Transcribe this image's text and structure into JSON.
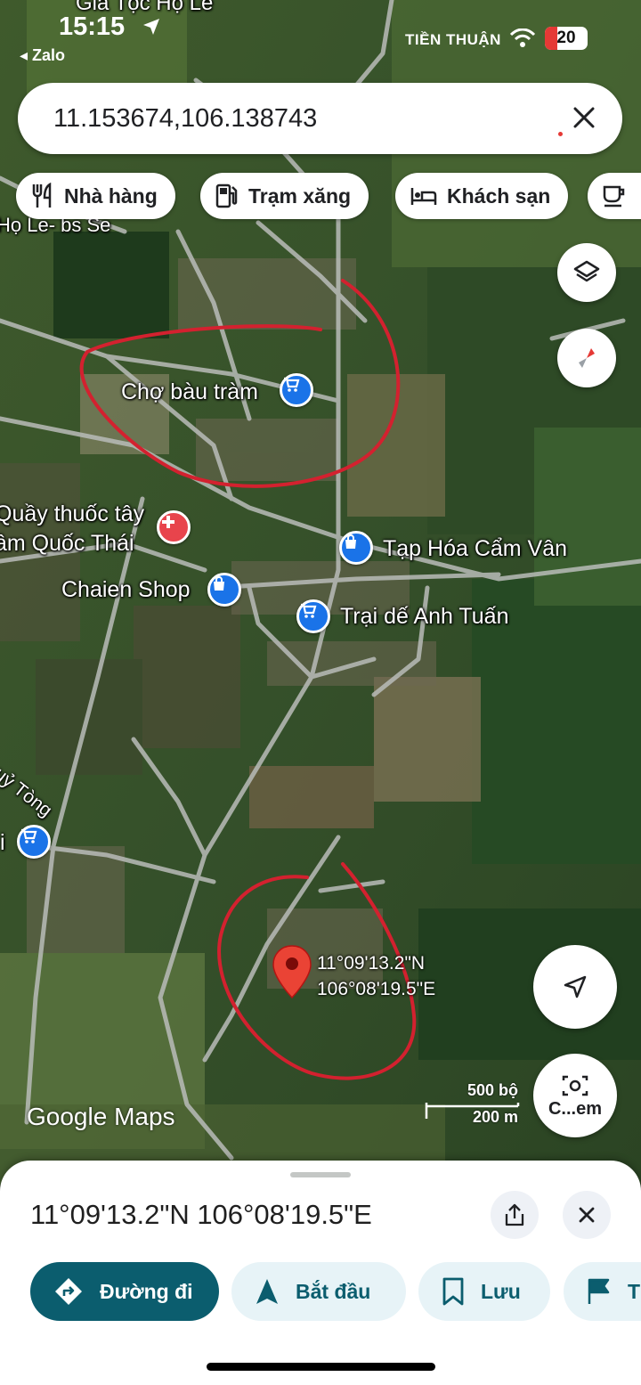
{
  "status_bar": {
    "time": "15:15",
    "back_app": "◂ Zalo",
    "carrier": "TIỀN THUẬN",
    "battery": "20"
  },
  "search": {
    "value": "11.153674,106.138743"
  },
  "chips": [
    {
      "label": "Nhà hàng",
      "icon": "restaurant-icon"
    },
    {
      "label": "Trạm xăng",
      "icon": "gas-station-icon"
    },
    {
      "label": "Khách sạn",
      "icon": "hotel-icon"
    }
  ],
  "map": {
    "top_partial_label": "Gia Tộc Họ Lê",
    "left_partial_label": "Họ Le- bs Se",
    "places": {
      "market": "Chợ bàu tràm",
      "pharmacy_line1": "Quầy thuốc tây",
      "pharmacy_line2": "âm Quốc Thái",
      "grocery": "Tạp Hóa Cẩm Vân",
      "chaien": "Chaien Shop",
      "farm": "Trại dế Anh Tuấn",
      "road": "huỷ Tòng",
      "left_shop": "i"
    },
    "pin_coords_line1": "11°09'13.2\"N",
    "pin_coords_line2": "106°08'19.5\"E",
    "google_logo": "Google Maps",
    "scale_top": "500 bộ",
    "scale_bottom": "200 m",
    "camera_label": "C...em"
  },
  "sheet": {
    "title": "11°09'13.2\"N 106°08'19.5\"E",
    "actions": [
      {
        "label": "Đường đi",
        "icon": "directions-icon"
      },
      {
        "label": "Bắt đầu",
        "icon": "navigation-arrow-icon"
      },
      {
        "label": "Lưu",
        "icon": "bookmark-icon"
      },
      {
        "label": "T",
        "icon": "flag-icon"
      }
    ]
  },
  "colors": {
    "primary_action": "#0b5d6e",
    "secondary_action_bg": "#e7f3f7",
    "pin_blue": "#1a73e8",
    "pin_red": "#e8444c",
    "annotation_red": "#d3212f"
  }
}
